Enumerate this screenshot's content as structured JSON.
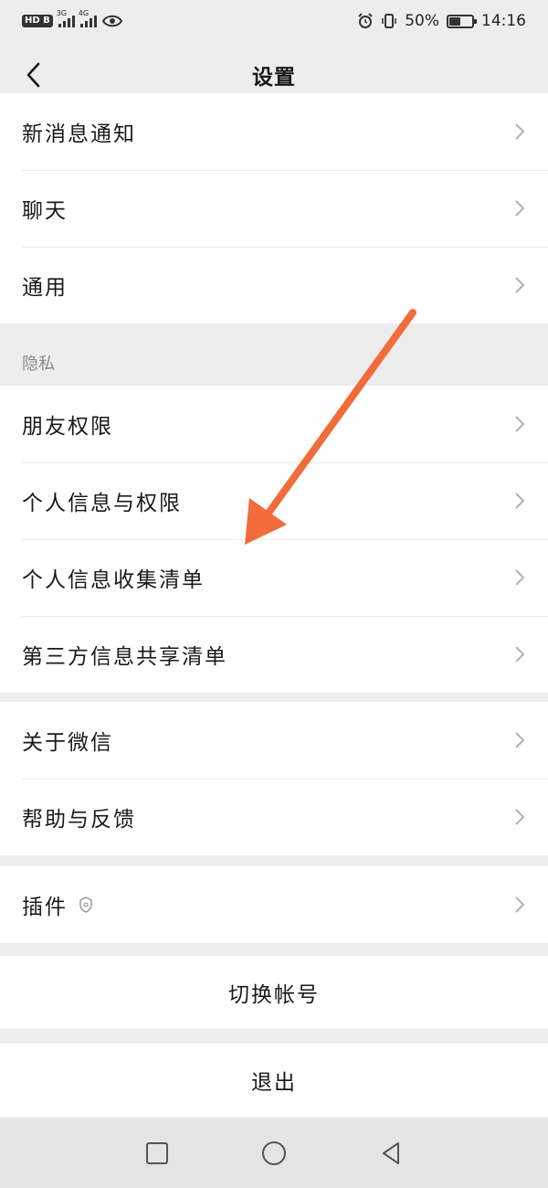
{
  "statusbar": {
    "hd_badge": "HD B",
    "sig1_label": "3G",
    "sig2_label": "4G",
    "battery_percent": "50%",
    "battery_level": 0.5,
    "time": "14:16"
  },
  "navbar": {
    "title": "设置",
    "back_icon": "chevron-left-icon"
  },
  "groups": {
    "general": [
      {
        "label": "新消息通知"
      },
      {
        "label": "聊天"
      },
      {
        "label": "通用"
      }
    ],
    "privacy_title": "隐私",
    "privacy": [
      {
        "label": "朋友权限"
      },
      {
        "label": "个人信息与权限"
      },
      {
        "label": "个人信息收集清单"
      },
      {
        "label": "第三方信息共享清单"
      }
    ],
    "about": [
      {
        "label": "关于微信"
      },
      {
        "label": "帮助与反馈"
      }
    ],
    "plugins": [
      {
        "label": "插件"
      }
    ]
  },
  "actions": {
    "switch_account": "切换帐号",
    "logout": "退出"
  },
  "colors": {
    "background": "#ededed",
    "cell": "#ffffff",
    "arrow": "#f26b3a",
    "chevron": "#b2b2b2"
  },
  "icons": {
    "chevron": "chevron-right-icon",
    "plugin": "plugin-shield-icon",
    "alarm": "alarm-icon",
    "vibrate": "vibrate-icon",
    "eye": "eye-icon",
    "sys_recent": "square-icon",
    "sys_home": "circle-icon",
    "sys_back": "triangle-back-icon"
  }
}
